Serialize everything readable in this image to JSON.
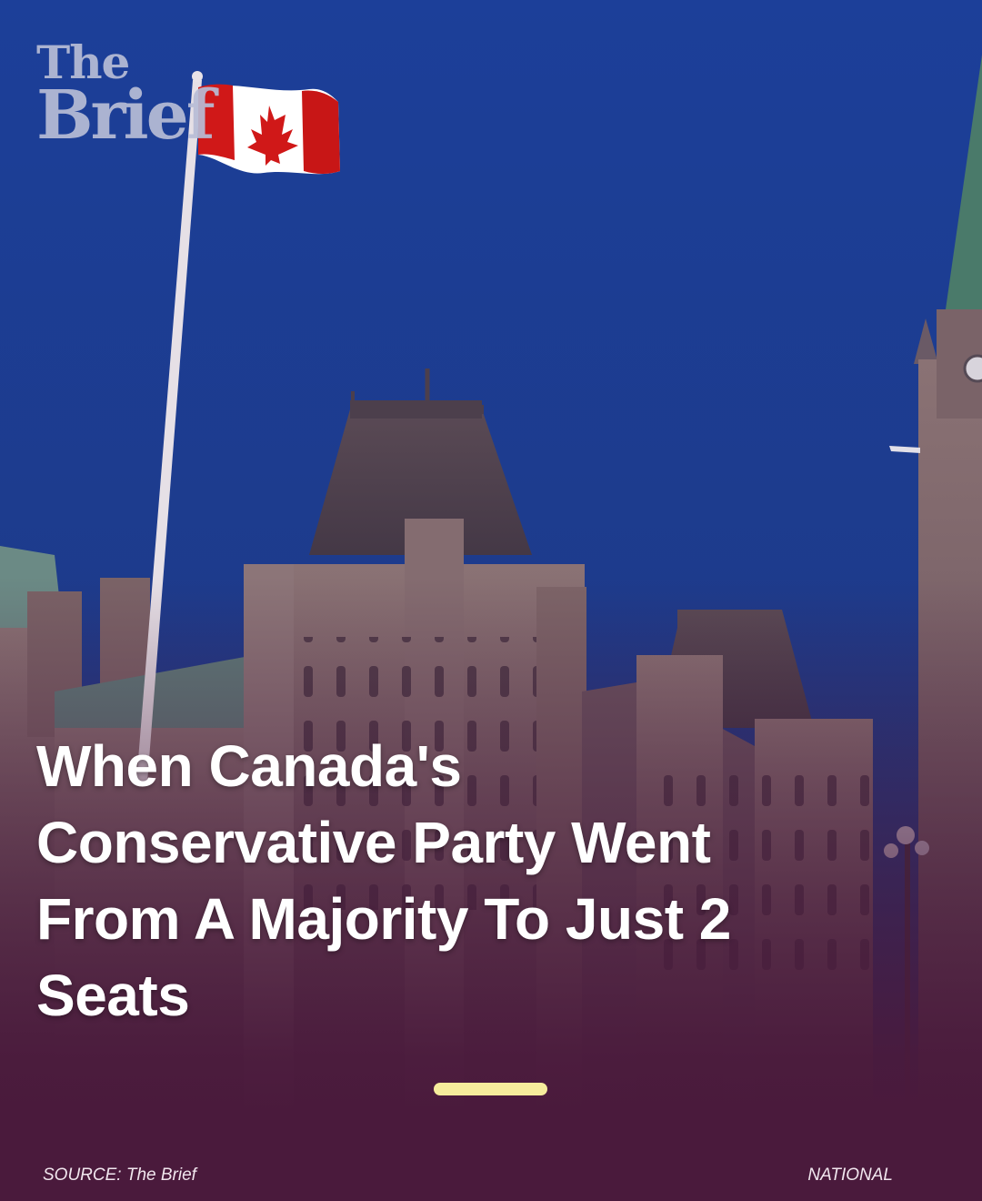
{
  "brand": {
    "line1": "The",
    "line2": "Brief"
  },
  "headline": "When Canada's Conservative Party Went From A Majority To Just 2 Seats",
  "footer": {
    "source": "SOURCE: The Brief",
    "category": "NATIONAL"
  },
  "colors": {
    "accent_bar": "#f6ec9c",
    "background": "#4a1a3c",
    "sky": "#1e3a8f"
  },
  "image": {
    "subject": "parliament-building-with-canadian-flag"
  }
}
